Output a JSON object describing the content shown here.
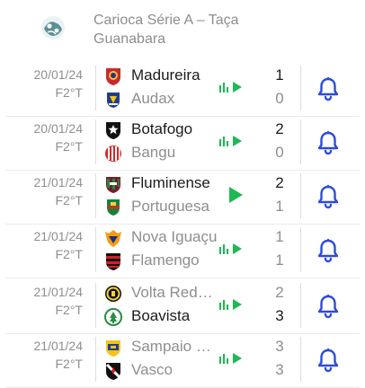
{
  "league": {
    "title": "Carioca Série A – Taça Guanabara",
    "logo_icon": "carioca-league-logo-icon"
  },
  "colors": {
    "accent_blue": "#2d4bd8",
    "live_green": "#1db954",
    "muted": "#8e8e8e"
  },
  "matches": [
    {
      "date": "20/01/24",
      "status": "F2°T",
      "home": {
        "name": "Madureira",
        "score": "1",
        "crest": "madureira-crest-icon"
      },
      "away": {
        "name": "Audax",
        "score": "0",
        "crest": "audax-crest-icon"
      },
      "media_icon": "live-stats-play-icon"
    },
    {
      "date": "20/01/24",
      "status": "F2°T",
      "home": {
        "name": "Botafogo",
        "score": "2",
        "crest": "botafogo-crest-icon"
      },
      "away": {
        "name": "Bangu",
        "score": "0",
        "crest": "bangu-crest-icon"
      },
      "media_icon": "live-stats-play-icon"
    },
    {
      "date": "21/01/24",
      "status": "F2°T",
      "home": {
        "name": "Fluminense",
        "score": "2",
        "crest": "fluminense-crest-icon"
      },
      "away": {
        "name": "Portuguesa",
        "score": "1",
        "crest": "portuguesa-crest-icon"
      },
      "media_icon": "play-icon"
    },
    {
      "date": "21/01/24",
      "status": "F2°T",
      "home": {
        "name": "Nova Iguaçu",
        "score": "1",
        "crest": "nova-iguacu-crest-icon"
      },
      "away": {
        "name": "Flamengo",
        "score": "1",
        "crest": "flamengo-crest-icon"
      },
      "media_icon": "live-stats-play-icon"
    },
    {
      "date": "21/01/24",
      "status": "F2°T",
      "home": {
        "name": "Volta Redonda",
        "score": "2",
        "crest": "volta-redonda-crest-icon"
      },
      "away": {
        "name": "Boavista",
        "score": "3",
        "crest": "boavista-crest-icon"
      },
      "media_icon": "live-stats-play-icon"
    },
    {
      "date": "21/01/24",
      "status": "F2°T",
      "home": {
        "name": "Sampaio Corrêa",
        "score": "3",
        "crest": "sampaio-correa-crest-icon"
      },
      "away": {
        "name": "Vasco",
        "score": "3",
        "crest": "vasco-crest-icon"
      },
      "media_icon": "live-stats-play-icon"
    }
  ]
}
